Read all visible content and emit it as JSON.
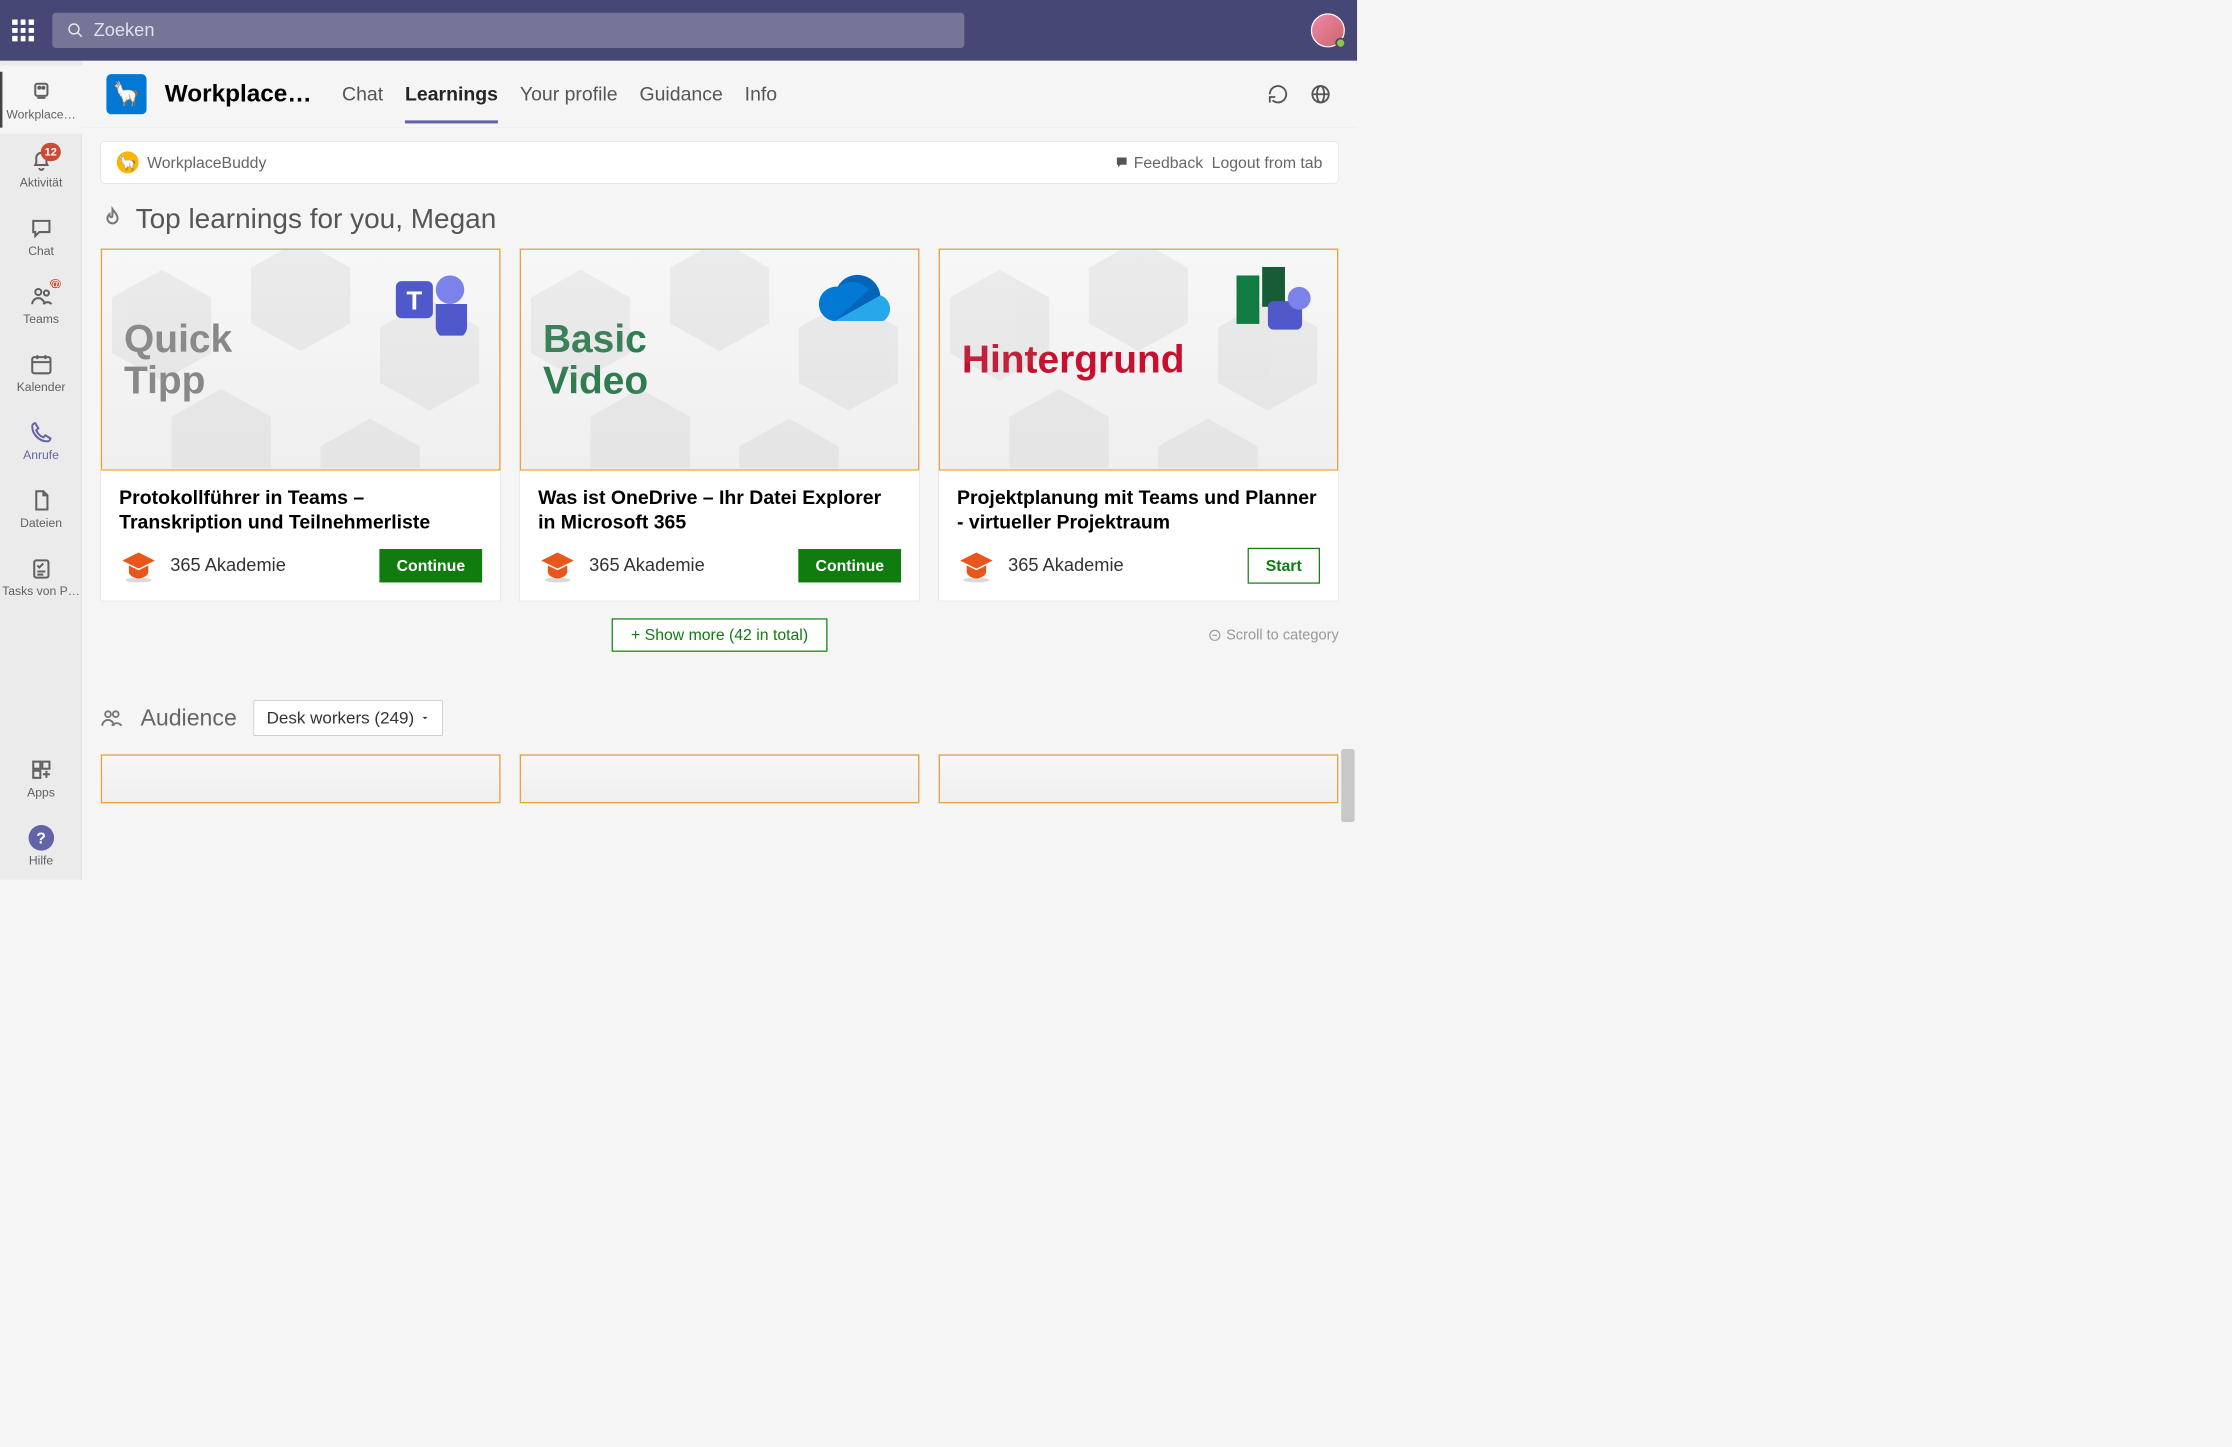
{
  "topbar": {
    "search_placeholder": "Zoeken"
  },
  "rail": {
    "activity_badge": "12",
    "items": {
      "workplace": "Workplace…",
      "activity": "Aktivität",
      "chat": "Chat",
      "teams": "Teams",
      "calendar": "Kalender",
      "calls": "Anrufe",
      "files": "Dateien",
      "tasks": "Tasks von P…",
      "apps": "Apps",
      "help": "Hilfe"
    }
  },
  "app_header": {
    "title": "Workplace…",
    "tabs": {
      "chat": "Chat",
      "learnings": "Learnings",
      "profile": "Your profile",
      "guidance": "Guidance",
      "info": "Info"
    }
  },
  "tab_bar": {
    "brand": "WorkplaceBuddy",
    "feedback": "Feedback",
    "logout": "Logout from tab"
  },
  "section": {
    "heading": "Top learnings for you, Megan"
  },
  "cards": [
    {
      "hero_text": "Quick\nTipp",
      "hero_class": "gray",
      "icon": "teams",
      "title": "Protokollführer in Teams – Transkription und Teilnehmerliste",
      "provider": "365 Akademie",
      "button": "Continue",
      "button_class": "continue"
    },
    {
      "hero_text": "Basic\nVideo",
      "hero_class": "green",
      "icon": "onedrive",
      "title": "Was ist OneDrive – Ihr Datei Explorer in Microsoft 365",
      "provider": "365 Akademie",
      "button": "Continue",
      "button_class": "continue"
    },
    {
      "hero_text": "Hintergrund",
      "hero_class": "red",
      "icon": "planner",
      "title": "Projektplanung mit Teams und Planner - virtueller Projektraum",
      "provider": "365 Akademie",
      "button": "Start",
      "button_class": "start"
    }
  ],
  "show_more": "+  Show more (42 in total)",
  "scroll_cat": "Scroll to category",
  "audience": {
    "label": "Audience",
    "selected": "Desk workers (249)"
  }
}
